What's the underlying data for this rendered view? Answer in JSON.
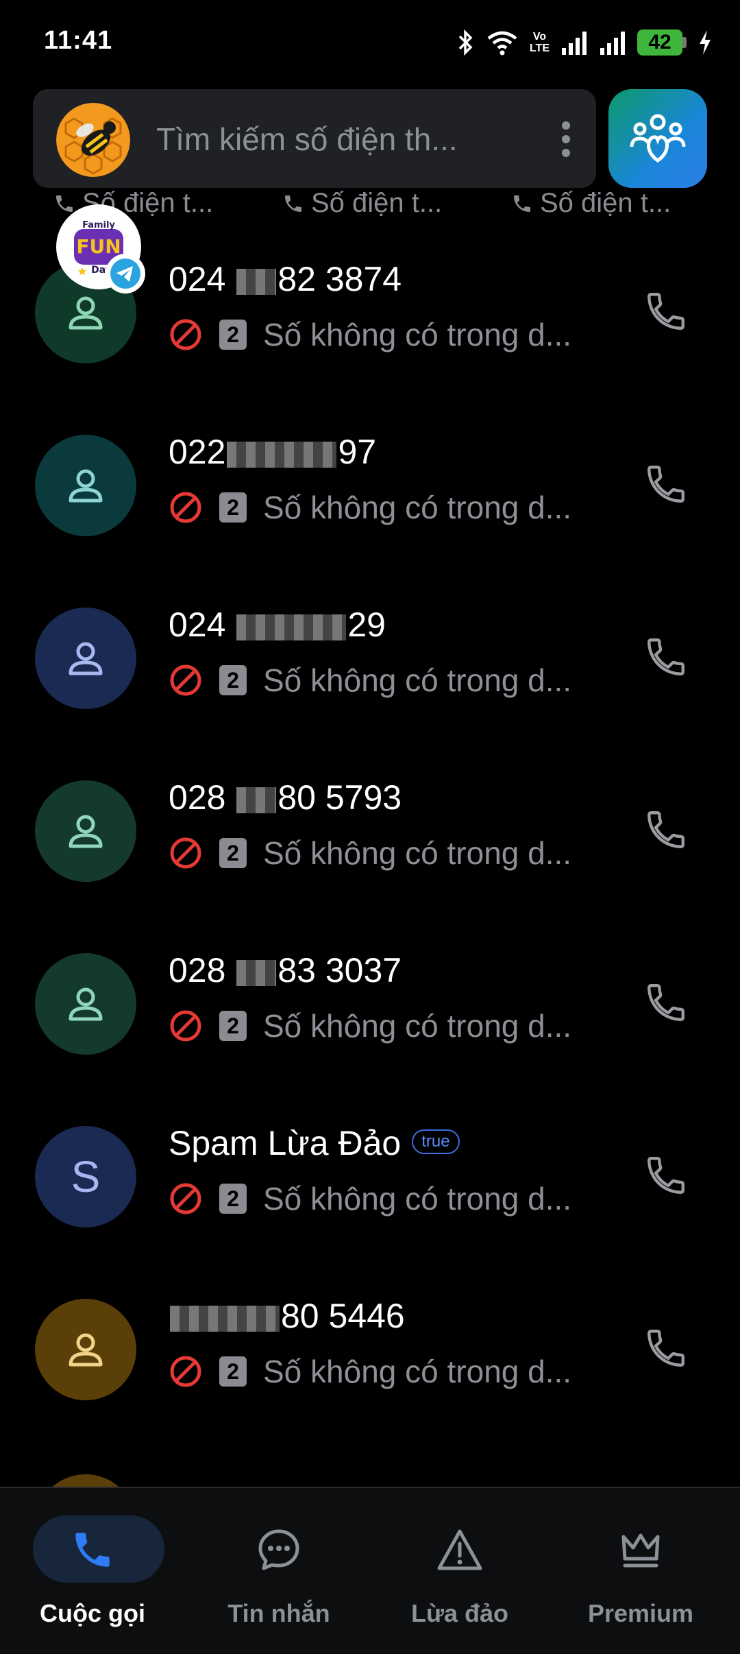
{
  "status_bar": {
    "time": "11:41",
    "volte_line1": "Vo",
    "volte_line2": "LTE",
    "battery": "42",
    "icons": [
      "bluetooth-icon",
      "wifi-icon",
      "volte-icon",
      "signal-icon",
      "signal-icon",
      "battery-icon",
      "charging-icon"
    ]
  },
  "header": {
    "search_placeholder": "Tìm kiếm số điện th...",
    "chips": [
      {
        "label": "Số điện t..."
      },
      {
        "label": "Số điện t..."
      },
      {
        "label": "Số điện t..."
      }
    ]
  },
  "bubble": {
    "text_line1": "Family",
    "text_line2": "FUN",
    "text_line3": "Day"
  },
  "calls": [
    {
      "number_prefix": "024 ",
      "number_suffix": "82 3874",
      "sim": "2",
      "status": "Số không có trong d...",
      "avatar_bg": "#0f3a2a",
      "avatar_fg": "#8fd6b4"
    },
    {
      "number_prefix": "022",
      "number_suffix": "97",
      "sim": "2",
      "status": "Số không có trong d...",
      "avatar_bg": "#0b3a3c",
      "avatar_fg": "#8fd4d4"
    },
    {
      "number_prefix": "024 ",
      "number_suffix": "29",
      "sim": "2",
      "status": "Số không có trong d...",
      "avatar_bg": "#1b2a52",
      "avatar_fg": "#a8b8f0"
    },
    {
      "number_prefix": "028 ",
      "number_suffix": "80 5793",
      "sim": "2",
      "status": "Số không có trong d...",
      "avatar_bg": "#143a30",
      "avatar_fg": "#8fd6bc"
    },
    {
      "number_prefix": "028 ",
      "number_suffix": "83 3037",
      "sim": "2",
      "status": "Số không có trong d...",
      "avatar_bg": "#143a30",
      "avatar_fg": "#8fd6bc"
    },
    {
      "name": "Spam Lừa Đảo",
      "badge": "true",
      "letter": "S",
      "sim": "2",
      "status": "Số không có trong d...",
      "avatar_bg": "#1b2a52",
      "avatar_fg": "#a8b8f0"
    },
    {
      "number_prefix": "",
      "number_suffix": "80 5446",
      "sim": "2",
      "status": "Số không có trong d...",
      "avatar_bg": "#5a3f08",
      "avatar_fg": "#f2d38a"
    }
  ],
  "nav": {
    "items": [
      {
        "label": "Cuộc gọi",
        "icon": "phone-icon",
        "active": true
      },
      {
        "label": "Tin nhắn",
        "icon": "message-icon",
        "active": false
      },
      {
        "label": "Lừa đảo",
        "icon": "warning-icon",
        "active": false
      },
      {
        "label": "Premium",
        "icon": "crown-icon",
        "active": false
      }
    ]
  },
  "colors": {
    "background": "#000000",
    "block_red": "#e53935",
    "accent_blue": "#2f7cf6",
    "battery_green": "#3fb63b"
  }
}
